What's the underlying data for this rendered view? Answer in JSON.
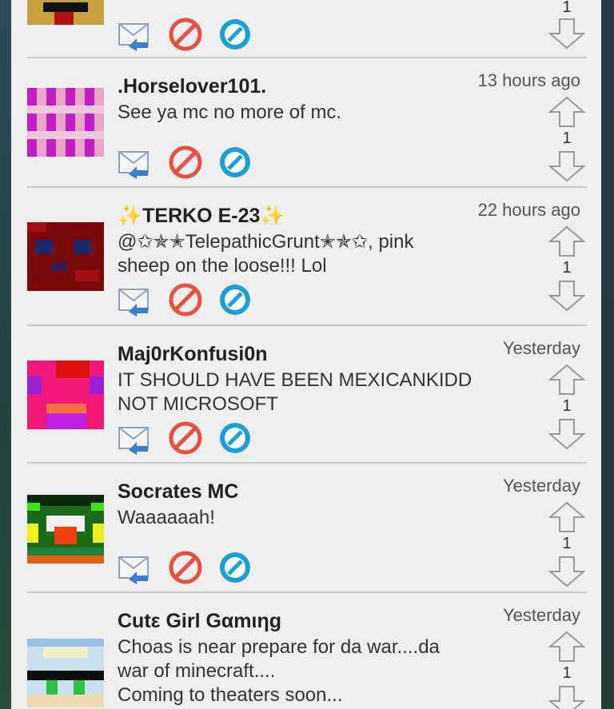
{
  "comments": [
    {
      "user": "",
      "time": "",
      "lines": [],
      "votes": "1"
    },
    {
      "user": ".Horselover101.",
      "time": "13 hours ago",
      "lines": [
        "See ya mc no more of mc."
      ],
      "votes": "1"
    },
    {
      "user": "✨TERKO E-23✨",
      "time": "22 hours ago",
      "lines": [
        "@✩✯✭TelepathicGrunt✭✯✩, pink",
        "sheep on the loose!!! Lol"
      ],
      "votes": "1"
    },
    {
      "user": "Maj0rKonfusi0n",
      "time": "Yesterday",
      "lines": [
        "IT SHOULD HAVE BEEN MEXICANKIDD",
        "NOT MICROSOFT"
      ],
      "votes": "1"
    },
    {
      "user": "Socrates MC",
      "time": "Yesterday",
      "lines": [
        "Waaaaaah!"
      ],
      "votes": "1"
    },
    {
      "user": "Cutε Girl Gαmιηg",
      "time": "Yesterday",
      "lines": [
        "Choas is near prepare for da war....da",
        "war of minecraft....",
        "Coming to theaters soon..."
      ],
      "votes": "1"
    }
  ],
  "icons": {
    "reply": "reply-mail-icon",
    "block": "block-icon",
    "report": "report-icon",
    "up": "upvote-arrow-icon",
    "down": "downvote-arrow-icon"
  },
  "colors": {
    "block_red": "#e8503f",
    "report_blue": "#1aa0d8",
    "panel_bg": "#efefef"
  }
}
